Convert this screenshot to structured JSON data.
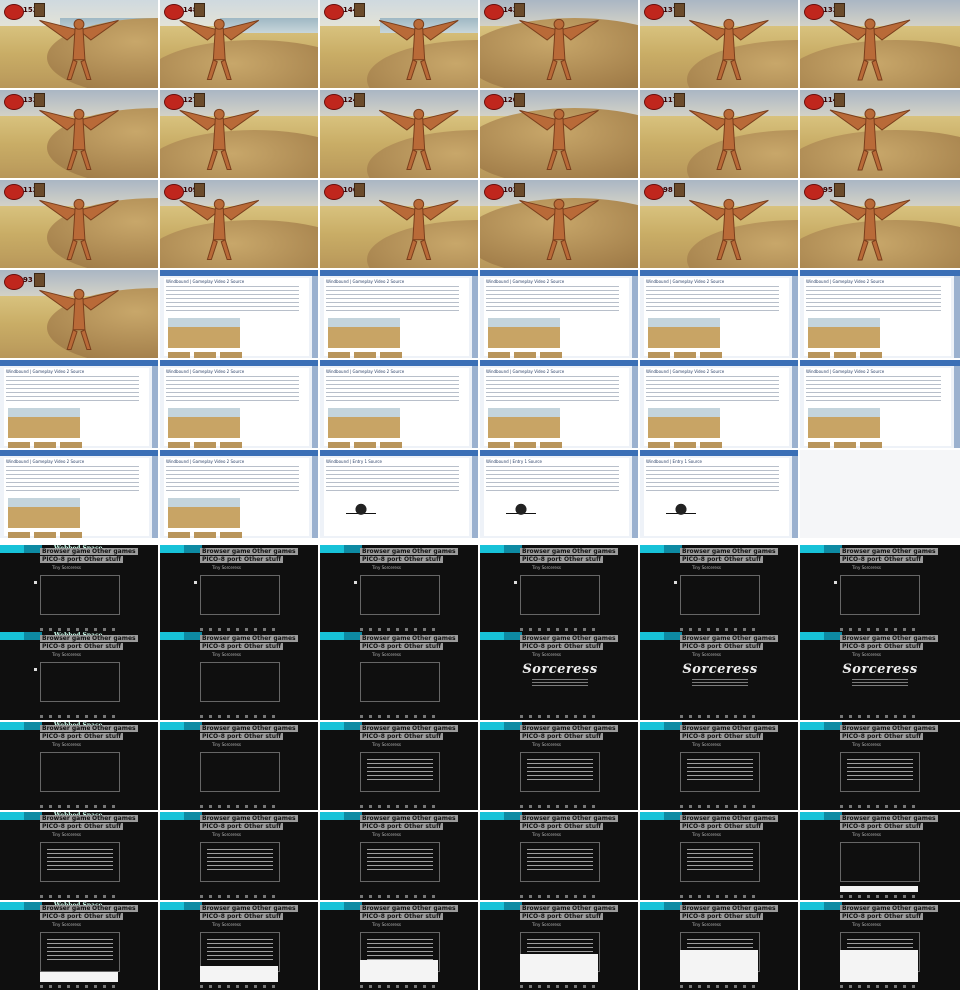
{
  "sheet": {
    "columns": 6,
    "rows": 11
  },
  "game": {
    "health_values": [
      "153",
      "148",
      "144",
      "143",
      "137",
      "133",
      "133",
      "127",
      "124",
      "120",
      "117",
      "114",
      "112",
      "109",
      "106",
      "102",
      "98",
      "95",
      "93"
    ]
  },
  "browser": {
    "page_title": "Windbound | Gameplay Video 2 Source",
    "alt_title": "Windbound | Entry 1 Source"
  },
  "site": {
    "banner_title": "Webbed Space",
    "nav_browser": "Browser games",
    "nav_other": "Other games",
    "nav_ports": "PICO-8 ports",
    "nav_stuff": "Other stuff",
    "subtitle": "Tiny Sorceress",
    "logo_text": "Sorceress"
  }
}
